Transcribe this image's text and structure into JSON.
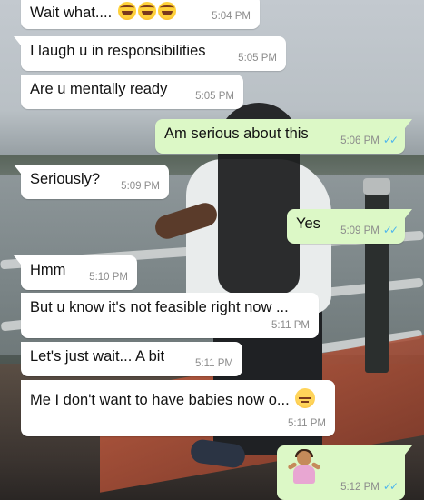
{
  "conversation": {
    "messages": [
      {
        "direction": "in",
        "text": "Wait what....",
        "emoji": [
          "face-with-tears-of-joy-icon",
          "face-with-tears-of-joy-icon",
          "face-with-tears-of-joy-icon"
        ],
        "time": "5:04 PM"
      },
      {
        "direction": "in",
        "text": "I laugh u in responsibilities",
        "time": "5:05 PM"
      },
      {
        "direction": "in",
        "text": "Are u mentally ready",
        "time": "5:05 PM"
      },
      {
        "direction": "out",
        "text": "Am serious about this",
        "time": "5:06 PM",
        "status": "read"
      },
      {
        "direction": "in",
        "text": "Seriously?",
        "time": "5:09 PM"
      },
      {
        "direction": "out",
        "text": "Yes",
        "time": "5:09 PM",
        "status": "read"
      },
      {
        "direction": "in",
        "text": "Hmm",
        "time": "5:10 PM"
      },
      {
        "direction": "in",
        "text": "But u know it's not feasible right now ...",
        "time": "5:11 PM"
      },
      {
        "direction": "in",
        "text": "Let's just wait... A bit",
        "time": "5:11 PM"
      },
      {
        "direction": "in",
        "text": "Me I don't want to have babies now o...",
        "emoji": [
          "pensive-face-icon"
        ],
        "time": "5:11 PM"
      },
      {
        "direction": "out",
        "text": "",
        "emoji": [
          "person-shrugging-icon"
        ],
        "time": "5:12 PM",
        "status": "read"
      }
    ]
  },
  "colors": {
    "incoming_bubble": "#ffffff",
    "outgoing_bubble": "#dcf8c6",
    "timestamp": "#8c8c8c",
    "read_ticks": "#4fb6ec"
  }
}
